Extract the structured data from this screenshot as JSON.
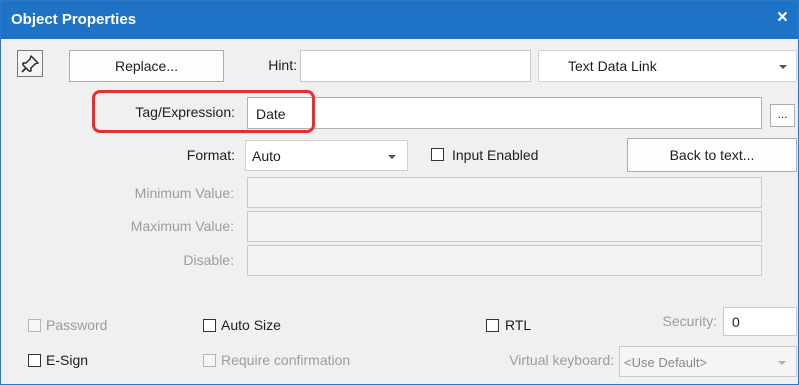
{
  "window": {
    "title": "Object Properties",
    "close_glyph": "×"
  },
  "toolbar": {
    "pin_icon": "pushpin-icon",
    "replace_label": "Replace...",
    "hint_label": "Hint:",
    "hint_value": "",
    "link_type_value": "Text Data Link"
  },
  "tag": {
    "label": "Tag/Expression:",
    "value": "Date",
    "browse_label": "..."
  },
  "format": {
    "label": "Format:",
    "value": "Auto"
  },
  "input_enabled": {
    "label": "Input Enabled",
    "checked": false
  },
  "back_to_text_label": "Back to text...",
  "minimum": {
    "label": "Minimum Value:",
    "value": ""
  },
  "maximum": {
    "label": "Maximum Value:",
    "value": ""
  },
  "disable": {
    "label": "Disable:",
    "value": ""
  },
  "options": {
    "password": {
      "label": "Password",
      "enabled": false
    },
    "auto_size": {
      "label": "Auto Size",
      "enabled": true
    },
    "rtl": {
      "label": "RTL",
      "enabled": true
    },
    "security": {
      "label": "Security:",
      "value": "0"
    },
    "esign": {
      "label": "E-Sign",
      "enabled": true
    },
    "require_confirmation": {
      "label": "Require confirmation",
      "enabled": false
    },
    "virtual_keyboard": {
      "label": "Virtual keyboard:",
      "value": "<Use Default>"
    }
  },
  "colors": {
    "titlebar": "#1f73c7",
    "highlight": "#e2312c",
    "window_bg": "#f0f0f0"
  }
}
